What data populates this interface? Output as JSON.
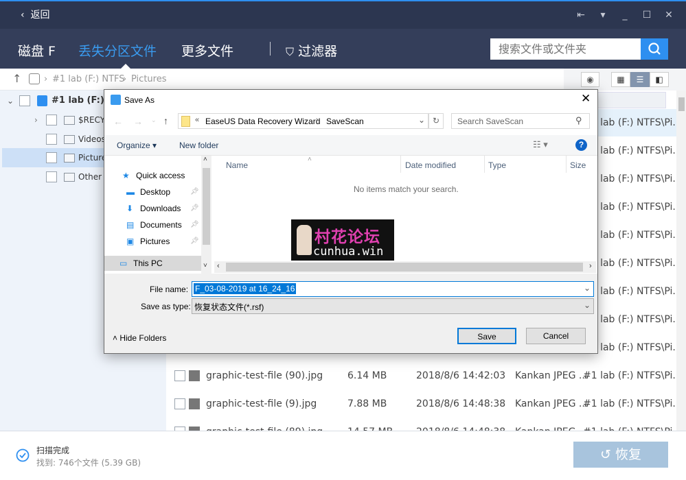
{
  "titlebar": {
    "back_label": "返回"
  },
  "nav": {
    "tabs": [
      {
        "label": "磁盘 F"
      },
      {
        "label": "丢失分区文件"
      },
      {
        "label": "更多文件"
      }
    ],
    "filter_label": "过滤器",
    "search_placeholder": "搜索文件或文件夹",
    "accent": "#2e8ff0"
  },
  "breadcrumb": {
    "items": [
      "#1 lab (F:) NTFS",
      "Pictures"
    ]
  },
  "tree": {
    "root": "#1 lab (F:) NTFS",
    "items": [
      {
        "label": "$RECYCLE.BIN"
      },
      {
        "label": "Videos"
      },
      {
        "label": "Pictures"
      },
      {
        "label": "Other lost files"
      }
    ]
  },
  "list": {
    "rows": [
      {
        "name": "",
        "size": "",
        "date": "",
        "type": "",
        "path": "#1 lab (F:) NTFS\\Pi..."
      },
      {
        "name": "",
        "size": "",
        "date": "",
        "type": "",
        "path": "#1 lab (F:) NTFS\\Pi..."
      },
      {
        "name": "",
        "size": "",
        "date": "",
        "type": "",
        "path": "#1 lab (F:) NTFS\\Pi..."
      },
      {
        "name": "",
        "size": "",
        "date": "",
        "type": "",
        "path": "#1 lab (F:) NTFS\\Pi..."
      },
      {
        "name": "",
        "size": "",
        "date": "",
        "type": "",
        "path": "#1 lab (F:) NTFS\\Pi..."
      },
      {
        "name": "",
        "size": "",
        "date": "",
        "type": "",
        "path": "#1 lab (F:) NTFS\\Pi..."
      },
      {
        "name": "",
        "size": "",
        "date": "",
        "type": "",
        "path": "#1 lab (F:) NTFS\\Pi..."
      },
      {
        "name": "",
        "size": "",
        "date": "",
        "type": "",
        "path": "#1 lab (F:) NTFS\\Pi..."
      },
      {
        "name": "",
        "size": "",
        "date": "",
        "type": "",
        "path": "#1 lab (F:) NTFS\\Pi..."
      },
      {
        "name": "graphic-test-file (90).jpg",
        "size": "6.14 MB",
        "date": "2018/8/6 14:42:03",
        "type": "Kankan JPEG ...",
        "path": "#1 lab (F:) NTFS\\Pi..."
      },
      {
        "name": "graphic-test-file (9).jpg",
        "size": "7.88 MB",
        "date": "2018/8/6 14:48:38",
        "type": "Kankan JPEG ...",
        "path": "#1 lab (F:) NTFS\\Pi..."
      },
      {
        "name": "graphic-test-file (89).jpg",
        "size": "14.57 MB",
        "date": "2018/8/6 14:48:38",
        "type": "Kankan JPEG ...",
        "path": "#1 lab (F:) NTFS\\Pi..."
      }
    ]
  },
  "status": {
    "title": "扫描完成",
    "found": "找到: 746个文件 (5.39 GB)",
    "restore_label": "恢复"
  },
  "dialog": {
    "title": "Save As",
    "address": [
      "EaseUS Data Recovery Wizard",
      "SaveScan"
    ],
    "search_placeholder": "Search SaveScan",
    "organize": "Organize",
    "new_folder": "New folder",
    "nav": [
      {
        "label": "Quick access"
      },
      {
        "label": "Desktop"
      },
      {
        "label": "Downloads"
      },
      {
        "label": "Documents"
      },
      {
        "label": "Pictures"
      },
      {
        "label": "This PC"
      }
    ],
    "columns": [
      "Name",
      "Date modified",
      "Type",
      "Size"
    ],
    "empty": "No items match your search.",
    "file_name_label": "File name:",
    "file_name": "F_03-08-2019 at 16_24_16",
    "type_label": "Save as type:",
    "type_value": "恢复状态文件(*.rsf)",
    "hide_folders": "Hide Folders",
    "save": "Save",
    "cancel": "Cancel"
  },
  "watermark": {
    "text_cn": "村花论坛",
    "text_en": "cunhua.win"
  }
}
